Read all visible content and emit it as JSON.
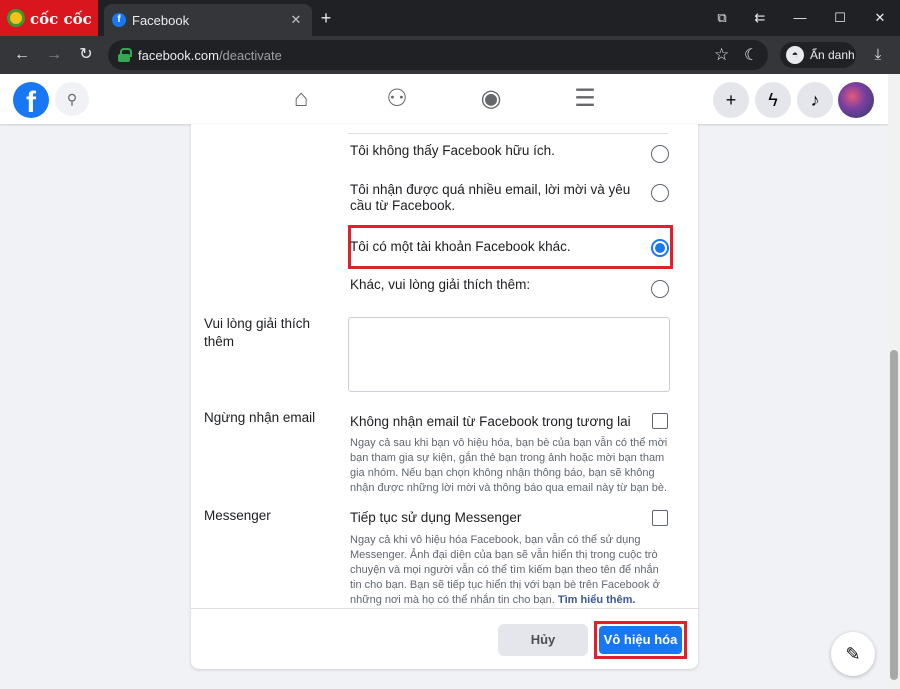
{
  "browser": {
    "brand": "cốc cốc",
    "tab_title": "Facebook",
    "tab_close": "✕",
    "new_tab": "+",
    "url_host": "facebook.com",
    "url_path": "/deactivate",
    "incognito_label": "Ẩn danh"
  },
  "fb_header": {
    "logo": "f",
    "nav_icons": [
      "home-icon",
      "friends-icon",
      "groups-icon",
      "menu-icon"
    ],
    "actions": [
      "plus-icon",
      "messenger-icon",
      "notifications-icon"
    ]
  },
  "reasons": [
    {
      "label": "Tôi không thấy Facebook hữu ích.",
      "checked": false
    },
    {
      "label": "Tôi nhận được quá nhiều email, lời mời và yêu cầu từ Facebook.",
      "checked": false
    },
    {
      "label": "Tôi có một tài khoản Facebook khác.",
      "checked": true
    },
    {
      "label": "Khác, vui lòng giải thích thêm:",
      "checked": false
    }
  ],
  "explain": {
    "label": "Vui lòng giải thích thêm",
    "value": ""
  },
  "email_optout": {
    "section_label": "Ngừng nhận email",
    "checkbox_label": "Không nhận email từ Facebook trong tương lai",
    "checked": false,
    "help": "Ngay cả sau khi bạn vô hiệu hóa, bạn bè của bạn vẫn có thể mời bạn tham gia sự kiện, gắn thẻ bạn trong ảnh hoặc mời bạn tham gia nhóm. Nếu bạn chọn không nhận thông báo, bạn sẽ không nhận được những lời mời và thông báo qua email này từ bạn bè."
  },
  "messenger": {
    "section_label": "Messenger",
    "checkbox_label": "Tiếp tục sử dụng Messenger",
    "checked": false,
    "help": "Ngay cả khi vô hiệu hóa Facebook, bạn vẫn có thể sử dụng Messenger. Ảnh đại diện của bạn sẽ vẫn hiển thị trong cuộc trò chuyện và mọi người vẫn có thể tìm kiếm bạn theo tên để nhắn tin cho bạn. Bạn sẽ tiếp tục hiển thị với bạn bè trên Facebook ở những nơi mà họ có thể nhắn tin cho bạn.",
    "learn_more": "Tìm hiểu thêm."
  },
  "footer": {
    "cancel_label": "Hủy",
    "deactivate_label": "Vô hiệu hóa"
  },
  "colors": {
    "fb_blue": "#1877f2",
    "highlight_red": "#e0202b"
  }
}
